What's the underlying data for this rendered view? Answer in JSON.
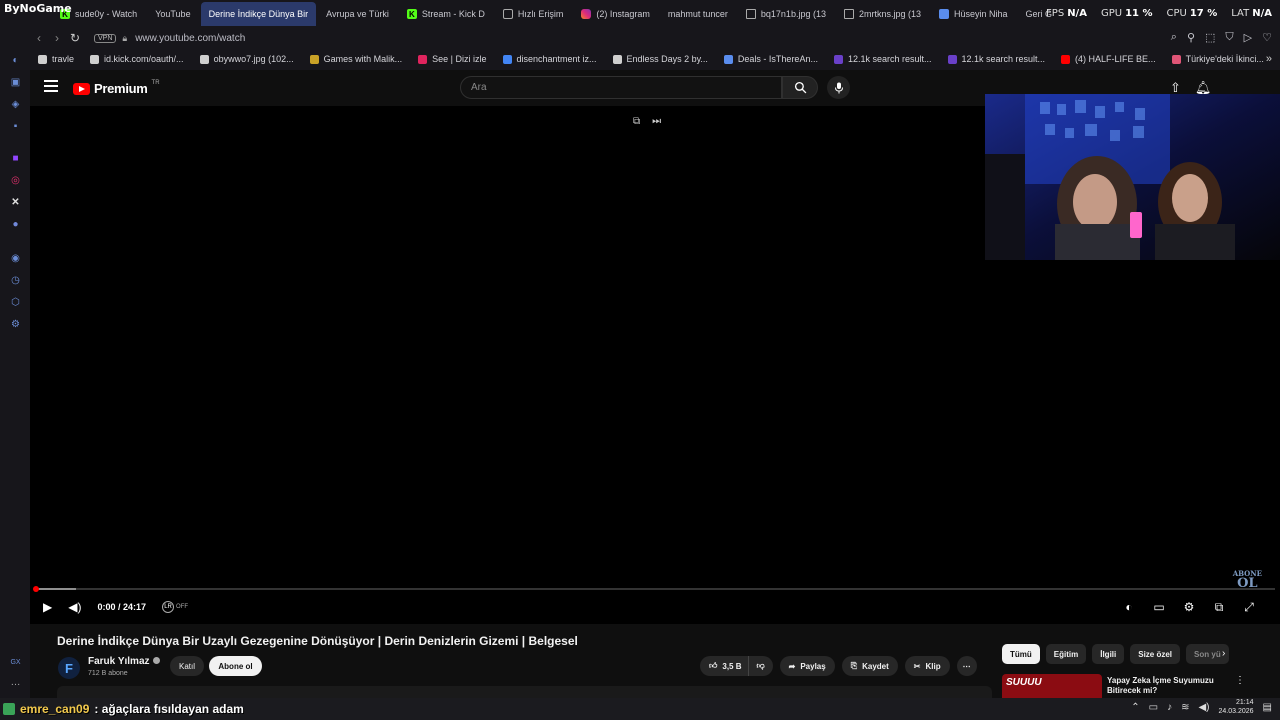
{
  "overlay": {
    "brand": "ByNoGame",
    "stats": [
      {
        "key": "FPS",
        "value": "N/A"
      },
      {
        "key": "GPU",
        "value": "11 %"
      },
      {
        "key": "CPU",
        "value": "17 %"
      },
      {
        "key": "LAT",
        "value": "N/A"
      }
    ]
  },
  "browser": {
    "tabs": [
      {
        "label": "sude0y - Watch",
        "icon": "kick",
        "active": false
      },
      {
        "label": "YouTube",
        "icon": "youtube",
        "active": false
      },
      {
        "label": "Derine İndikçe Dünya Bir",
        "icon": "youtube",
        "active": true
      },
      {
        "label": "Avrupa ve Türki",
        "icon": "youtube",
        "active": false
      },
      {
        "label": "Stream - Kick D",
        "icon": "kick",
        "active": false
      },
      {
        "label": "Hızlı Erişim",
        "icon": "grid",
        "active": false
      },
      {
        "label": "(2) Instagram",
        "icon": "instagram",
        "active": false
      },
      {
        "label": "mahmut tuncer",
        "icon": "youtube",
        "active": false
      },
      {
        "label": "bq17n1b.jpg (13",
        "icon": "image",
        "active": false
      },
      {
        "label": "2mrtkns.jpg (13",
        "icon": "image",
        "active": false
      },
      {
        "label": "Hüseyin Niha",
        "icon": "doc",
        "active": false
      },
      {
        "label": "Geri Gelen Ma",
        "icon": "youtube",
        "active": false
      }
    ],
    "address": {
      "vpn_label": "VPN",
      "url": "www.youtube.com/watch"
    },
    "bookmarks": [
      {
        "label": "travle",
        "color": "#cfcfcf"
      },
      {
        "label": "id.kick.com/oauth/...",
        "color": "#cfcfcf"
      },
      {
        "label": "obywwo7.jpg (102...",
        "color": "#cfcfcf"
      },
      {
        "label": "Games with Malik...",
        "color": "#c9a227"
      },
      {
        "label": "See | Dizi izle",
        "color": "#e0245e"
      },
      {
        "label": "disenchantment iz...",
        "color": "#4285f4"
      },
      {
        "label": "Endless Days 2 by...",
        "color": "#cfcfcf"
      },
      {
        "label": "Deals - IsThereAn...",
        "color": "#5a8dee"
      },
      {
        "label": "12.1k search result...",
        "color": "#6a40c9"
      },
      {
        "label": "12.1k search result...",
        "color": "#6a40c9"
      },
      {
        "label": "(4) HALF-LIFE BE...",
        "color": "#ff0000"
      },
      {
        "label": "Türkiye'deki İkinci...",
        "color": "#e05577"
      }
    ]
  },
  "youtube": {
    "logo_text": "Premium",
    "logo_region": "TR",
    "search_placeholder": "Ara",
    "player": {
      "current_time": "0:00",
      "duration": "24:17",
      "progress_fraction": 0.0,
      "buffered_fraction": 0.033,
      "lr_label": "OFF",
      "watermark_top": "ABONE",
      "watermark_bottom": "OL"
    },
    "video": {
      "title": "Derine İndikçe Dünya Bir Uzaylı Gezegenine Dönüşüyor | Derin Denizlerin Gizemi | Belgesel",
      "channel_initial": "F",
      "channel_name": "Faruk Yılmaz",
      "subscribers": "712 B abone",
      "join_label": "Katıl",
      "subscribe_label": "Abone ol",
      "likes": "3,5 B",
      "share_label": "Paylaş",
      "save_label": "Kaydet",
      "clip_label": "Klip"
    },
    "chips": [
      "Tümü",
      "Eğitim",
      "İlgili",
      "Size özel",
      "Son yü"
    ],
    "recommendation": {
      "thumb_text": "SUUUU",
      "title": "Yapay Zeka İçme Suyumuzu Bitirecek mi?"
    }
  },
  "chat": {
    "username": "emre_can09",
    "message": ": ağaçlara fısıldayan adam"
  },
  "taskbar": {
    "time": "21:14",
    "date": "24.03.2026"
  }
}
